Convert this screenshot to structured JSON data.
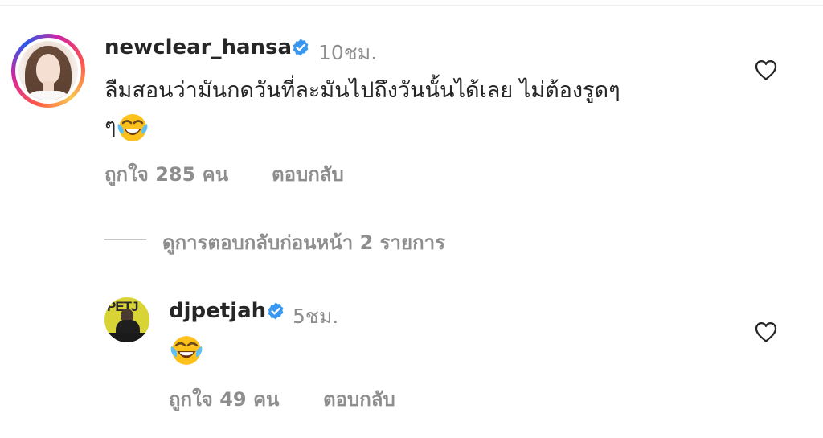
{
  "comments": [
    {
      "username": "newclear_hansa",
      "time": "10ชม.",
      "text_line1": "ลืมสอนว่ามันกดวันที่ละมันไปถึงวันนั้นได้เลย ไม่ต้องรูดๆ",
      "text_line2": "ๆ",
      "emoji": "face-with-tears-of-joy",
      "likes": "ถูกใจ 285 คน",
      "reply": "ตอบกลับ"
    },
    {
      "username": "djpetjah",
      "time": "5ชม.",
      "emoji": "face-with-tears-of-joy",
      "likes": "ถูกใจ 49 คน",
      "reply": "ตอบกลับ",
      "avatar_text": "PETJ"
    }
  ],
  "view_replies": "ดูการตอบกลับก่อนหน้า 2 รายการ",
  "colors": {
    "text": "#262626",
    "secondary": "#8e8e8e",
    "verified": "#3897f0"
  }
}
